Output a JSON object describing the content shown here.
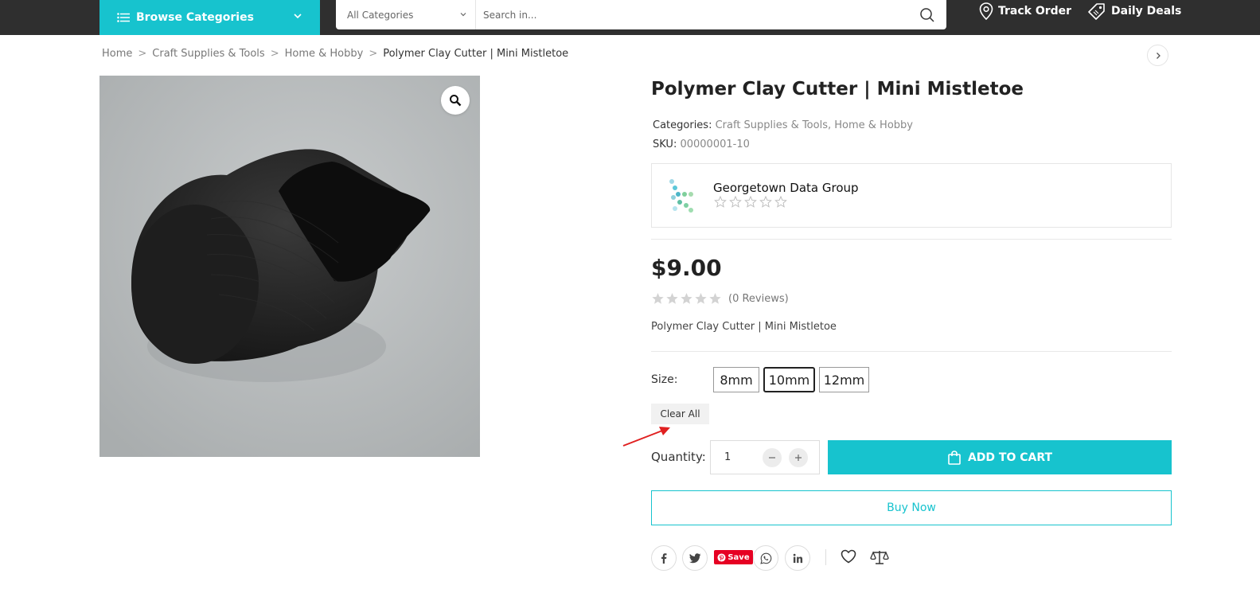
{
  "header": {
    "browse_label": "Browse Categories",
    "category_select": "All Categories",
    "search_placeholder": "Search in...",
    "track_order": "Track Order",
    "daily_deals": "Daily Deals"
  },
  "breadcrumb": {
    "items": [
      "Home",
      "Craft Supplies & Tools",
      "Home & Hobby"
    ],
    "current": "Polymer Clay Cutter | Mini Mistletoe"
  },
  "product": {
    "title": "Polymer Clay Cutter | Mini Mistletoe",
    "categories_label": "Categories:",
    "categories": [
      "Craft Supplies & Tools",
      "Home & Hobby"
    ],
    "sku_label": "SKU:",
    "sku": "00000001-10",
    "vendor": {
      "name": "Georgetown Data Group",
      "rating": 0,
      "max_rating": 5
    },
    "price": "$9.00",
    "rating": {
      "value": 0,
      "max": 5,
      "reviews_text": "(0 Reviews)"
    },
    "short_description": "Polymer Clay Cutter | Mini Mistletoe",
    "size_label": "Size:",
    "sizes": [
      "8mm",
      "10mm",
      "12mm"
    ],
    "selected_size": "10mm",
    "clear_label": "Clear All",
    "quantity_label": "Quantity:",
    "quantity": "1",
    "add_to_cart": "ADD TO CART",
    "buy_now": "Buy Now"
  },
  "share": {
    "pinterest_label": "Save",
    "icons": [
      "facebook-icon",
      "twitter-icon",
      "pinterest-icon",
      "whatsapp-icon",
      "linkedin-icon",
      "heart-icon",
      "compare-icon"
    ]
  },
  "colors": {
    "accent": "#17c3ce",
    "topbar": "#2f2f2f",
    "pinterest": "#e60023",
    "annotation_arrow": "#e02020"
  }
}
